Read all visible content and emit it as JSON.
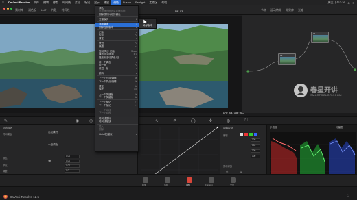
{
  "menubar": {
    "apple": "",
    "items": [
      "DaVinci Resolve",
      "文件",
      "编辑",
      "修剪",
      "时间线",
      "片段",
      "标记",
      "显示",
      "播放",
      "调色",
      "Fusion",
      "Fairlight",
      "工作区",
      "帮助"
    ],
    "active_index": 9,
    "right": [
      "周三 下午2:16",
      "Q",
      "≡"
    ]
  },
  "toolbar": {
    "labels": [
      "素材库",
      "调色板",
      "LUT",
      "片段",
      "时间线",
      "节点",
      "运动特效",
      "效果库",
      "光箱"
    ],
    "project": "NE-03",
    "timecode_top": "00:00:03:59",
    "node_label": "节点"
  },
  "viewer": {
    "timecode": "01:00:00:09"
  },
  "nodes": {
    "items": [
      {
        "id": "01",
        "label": "01"
      },
      {
        "id": "02",
        "label": "02"
      }
    ]
  },
  "watermark": {
    "cn": "春星开讲",
    "en": "SMARTCOLORX.COM"
  },
  "menu": {
    "items": [
      {
        "label": "调色",
        "type": "header"
      },
      {
        "label": "更新静态帧信息或静态帧",
        "type": "item",
        "disabled": true
      },
      {
        "label": "删除现有片段的调色",
        "type": "item"
      },
      {
        "label": "",
        "type": "sep"
      },
      {
        "label": "光谱模式",
        "type": "item",
        "arrow": true
      },
      {
        "label": "",
        "type": "sep"
      },
      {
        "label": "添加版本",
        "type": "item",
        "highlight": true,
        "arrow": true
      },
      {
        "label": "删除当前版本",
        "type": "item",
        "arrow": true
      },
      {
        "label": "",
        "type": "sep"
      },
      {
        "label": "正版",
        "type": "item",
        "shortcut": "⌥"
      },
      {
        "label": "预览",
        "type": "item",
        "shortcut": "⌥"
      },
      {
        "label": "清空",
        "type": "item",
        "shortcut": "⌥"
      },
      {
        "label": "",
        "type": "sep"
      },
      {
        "label": "快进",
        "type": "item",
        "shortcut": "⌥"
      },
      {
        "label": "快退",
        "type": "item",
        "shortcut": "⌥"
      },
      {
        "label": "",
        "type": "sep"
      },
      {
        "label": "复制/同步 旧版",
        "type": "item",
        "shortcut": "Space"
      },
      {
        "label": "播放/反向播放",
        "type": "item",
        "shortcut": "⌘C"
      },
      {
        "label": "播放到活动调色/旧",
        "type": "item",
        "shortcut": "⌘/"
      },
      {
        "label": "",
        "type": "sep"
      },
      {
        "label": "前一个调色",
        "type": "item",
        "shortcut": "⌥"
      },
      {
        "label": "前一帧",
        "type": "item",
        "shortcut": "⌥"
      },
      {
        "label": "前进一帧",
        "type": "item",
        "shortcut": "⌥"
      },
      {
        "label": "",
        "type": "sep"
      },
      {
        "label": "跳转",
        "type": "item",
        "arrow": true
      },
      {
        "label": "",
        "type": "sep"
      },
      {
        "label": "上一个节点/编辑",
        "type": "item",
        "shortcut": "⌘"
      },
      {
        "label": "下一个节点/编辑",
        "type": "item",
        "shortcut": "⌘"
      },
      {
        "label": "",
        "type": "sep"
      },
      {
        "label": "重复",
        "type": "item",
        "shortcut": "⌘"
      },
      {
        "label": "循环",
        "type": "item",
        "shortcut": "⌘L"
      },
      {
        "label": "",
        "type": "sep"
      },
      {
        "label": "上一个关键帧",
        "type": "item",
        "shortcut": "⌘"
      },
      {
        "label": "下一个关键帧",
        "type": "item",
        "shortcut": "⌘"
      },
      {
        "label": "",
        "type": "sep"
      },
      {
        "label": "上一个标记",
        "type": "item",
        "shortcut": "⇧↑"
      },
      {
        "label": "下一个标记",
        "type": "item",
        "shortcut": "⇧↓"
      },
      {
        "label": "",
        "type": "sep"
      },
      {
        "label": "上一个片段",
        "type": "item",
        "disabled": true
      },
      {
        "label": "下一个片段",
        "type": "item",
        "disabled": true
      },
      {
        "label": "",
        "type": "sep"
      },
      {
        "label": "时间线图标",
        "type": "item"
      },
      {
        "label": "时间线缩放",
        "type": "item"
      },
      {
        "label": "",
        "type": "sep"
      },
      {
        "label": "插入",
        "type": "item",
        "disabled": true
      },
      {
        "label": "删除",
        "type": "item",
        "disabled": true
      },
      {
        "label": "",
        "type": "sep"
      },
      {
        "label": "Cintel扫描仪",
        "type": "item",
        "arrow": true
      }
    ]
  },
  "submenu": {
    "items": [
      "",
      "局部版本"
    ]
  },
  "panels": {
    "camera_raw": "动态特效",
    "color_wheels": "色轮模式",
    "primary": "一级调色",
    "left_labels": [
      "时间模板",
      "颜色",
      "节点",
      "调整"
    ],
    "field_values": [
      "0.00",
      "0.00",
      "0.00",
      "0.0"
    ],
    "curve_ctrl_title": "曲线控制",
    "curve_labels": [
      "编辑",
      "柔和修剪"
    ],
    "curve_values": [
      "100",
      "100",
      "100",
      "100"
    ],
    "low_labels": [
      "低",
      "高"
    ],
    "low_values": [
      "50.0",
      "50.0",
      "0.0",
      "0.0"
    ],
    "scope_title": "示波器",
    "scope_mode": "分量图"
  },
  "page_tabs": {
    "labels": [
      "媒体",
      "剪辑",
      "调色",
      "Fairlight",
      "交付"
    ],
    "active_index": 2
  },
  "status": {
    "app_name": "DaVinci Resolve 12.5"
  },
  "colors": {
    "accent": "#2a6fd6",
    "scope_red": "#ff3a3a",
    "scope_green": "#3aff55",
    "scope_blue": "#3a6bff"
  }
}
